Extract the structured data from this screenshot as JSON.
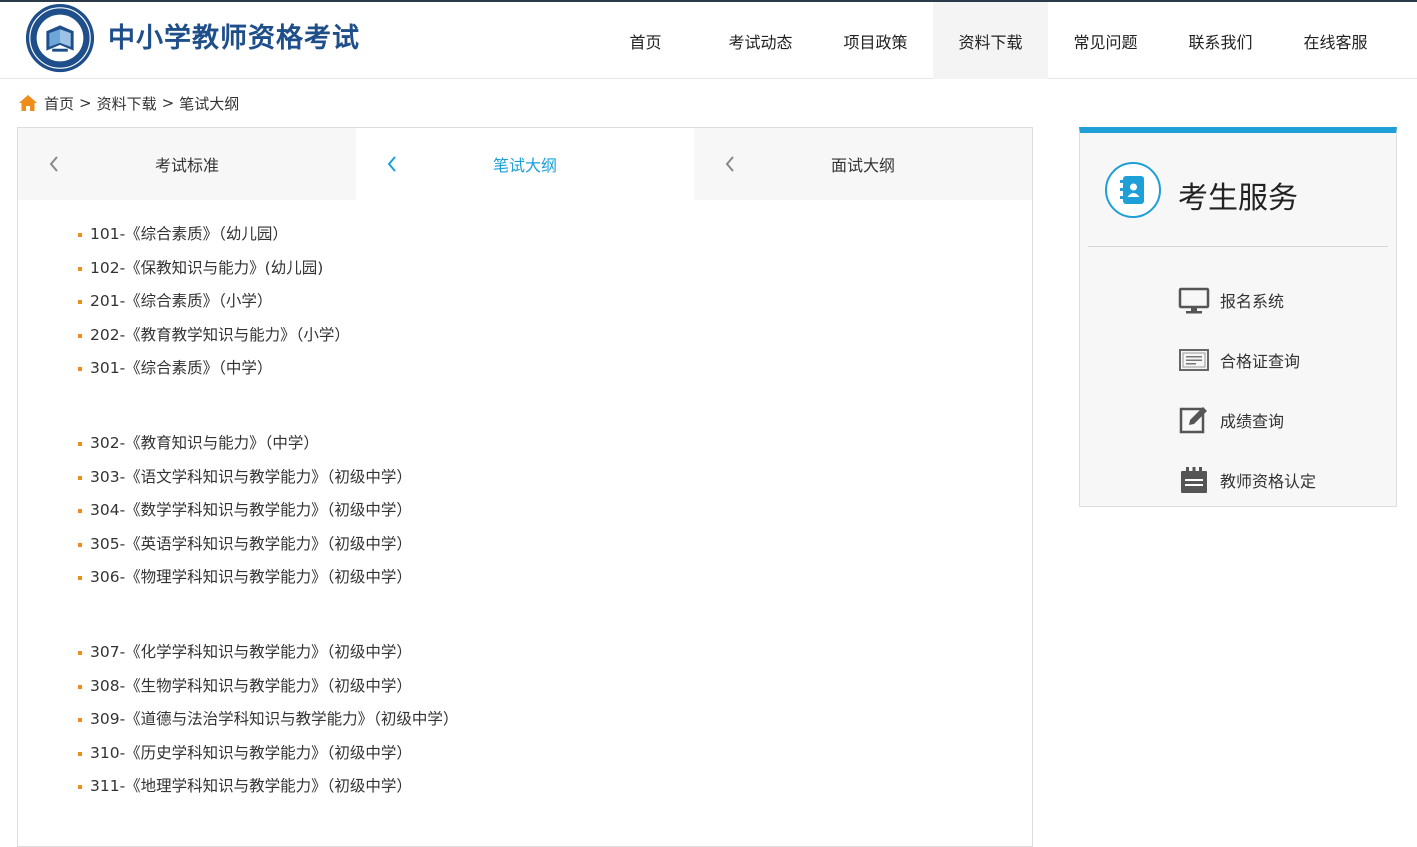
{
  "header": {
    "site_title": "中小学教师资格考试",
    "nav": [
      "首页",
      "考试动态",
      "项目政策",
      "资料下载",
      "常见问题",
      "联系我们",
      "在线客服"
    ],
    "active_nav": 3
  },
  "breadcrumb": {
    "items": [
      "首页",
      "资料下载",
      "笔试大纲"
    ],
    "separator": ">",
    "icon": "home-icon"
  },
  "tabs": [
    {
      "label": "考试标准",
      "active": false
    },
    {
      "label": "笔试大纲",
      "active": true
    },
    {
      "label": "面试大纲",
      "active": false
    }
  ],
  "syllabus_groups": [
    [
      "101-《综合素质》（幼儿园）",
      "102-《保教知识与能力》(幼儿园)",
      "201-《综合素质》（小学）",
      "202-《教育教学知识与能力》（小学）",
      "301-《综合素质》（中学）"
    ],
    [
      "302-《教育知识与能力》（中学）",
      "303-《语文学科知识与教学能力》（初级中学）",
      "304-《数学学科知识与教学能力》（初级中学）",
      "305-《英语学科知识与教学能力》（初级中学）",
      "306-《物理学科知识与教学能力》（初级中学）"
    ],
    [
      "307-《化学学科知识与教学能力》（初级中学）",
      "308-《生物学科知识与教学能力》（初级中学）",
      "309-《道德与法治学科知识与教学能力》（初级中学）",
      "310-《历史学科知识与教学能力》（初级中学）",
      "311-《地理学科知识与教学能力》（初级中学）"
    ]
  ],
  "sidebar": {
    "title": "考生服务",
    "services": [
      {
        "label": "报名系统",
        "icon": "monitor-icon"
      },
      {
        "label": "合格证查询",
        "icon": "certificate-icon"
      },
      {
        "label": "成绩查询",
        "icon": "edit-icon"
      },
      {
        "label": "教师资格认定",
        "icon": "calendar-icon"
      }
    ]
  },
  "colors": {
    "accent": "#1aa0d8",
    "bullet": "#f08c1a",
    "title": "#1f4f8a",
    "sidebar_bar": "#1e9fd8"
  }
}
